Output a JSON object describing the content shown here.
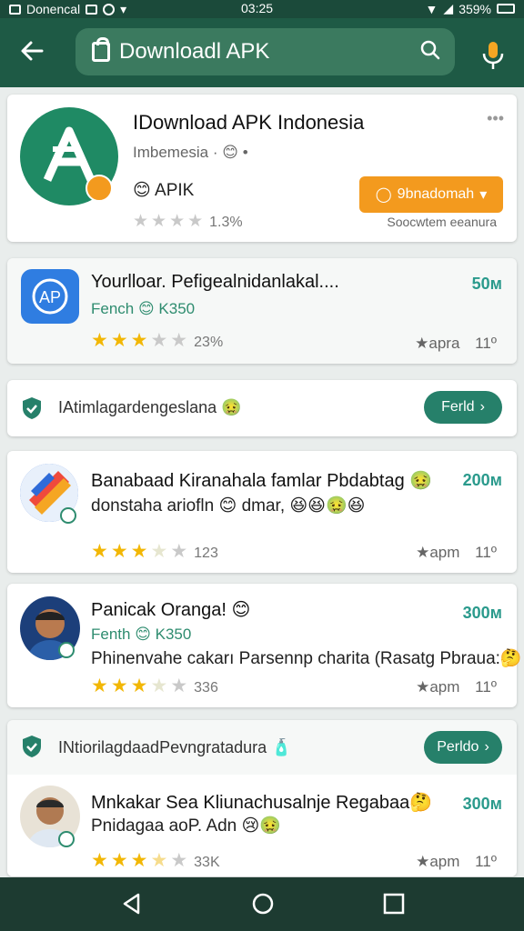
{
  "status": {
    "left_text": "Donencal",
    "time": "03:25",
    "battery": "359%"
  },
  "appbar": {
    "search_text": "Downloadl APK"
  },
  "featured": {
    "title": "IDownload APK Indonesia",
    "subtitle": "Imbemesia · 😊 •",
    "tag": "😊 APIK",
    "rating_count": "1.3%",
    "button_label": "9bnadomah",
    "caption": "Soocwtem eeanura",
    "more": "•••"
  },
  "items": [
    {
      "title": "Yourlloar. Pefigealnidanlakal....",
      "sub": "Fench 😊 K350",
      "size": "50м",
      "count": "23%",
      "meta1": "★apra",
      "meta2": "11º",
      "rating": 3
    },
    {
      "title": "Banabaad Kiranahala famlar Pbdabtag 🤢",
      "desc": "donstaha ariofln 😊 dmar, 😆😆🤢😆",
      "size": "200м",
      "count": "123",
      "meta1": "★apm",
      "meta2": "11º",
      "rating": 3
    },
    {
      "title": "Panicak Oranga! 😊",
      "sub": "Fenth 😊 K350",
      "desc": "Phinenvahe cakarı Parsennp charita (Rasatg Pbraua:🤔",
      "size": "300м",
      "count": "336",
      "meta1": "★apm",
      "meta2": "11º",
      "rating": 3
    },
    {
      "title": "Mnkakar Sea Kliunachusalnje Regabaa🤔",
      "sub": "Pnidagaa aoP. Adn 😢🤢",
      "size": "300м",
      "count": "33K",
      "meta1": "★apm",
      "meta2": "11º",
      "rating": 3
    }
  ],
  "banners": [
    {
      "text": "IAtimlagardengeslana 🤢",
      "button": "Ferld"
    },
    {
      "text": "INtiorilagdaadPevngratadura 🧴",
      "button": "Perldo"
    }
  ],
  "colors": {
    "appbar": "#1e5a45",
    "accent_teal": "#26806a",
    "accent_orange": "#f39a1e",
    "star": "#f2b705"
  }
}
